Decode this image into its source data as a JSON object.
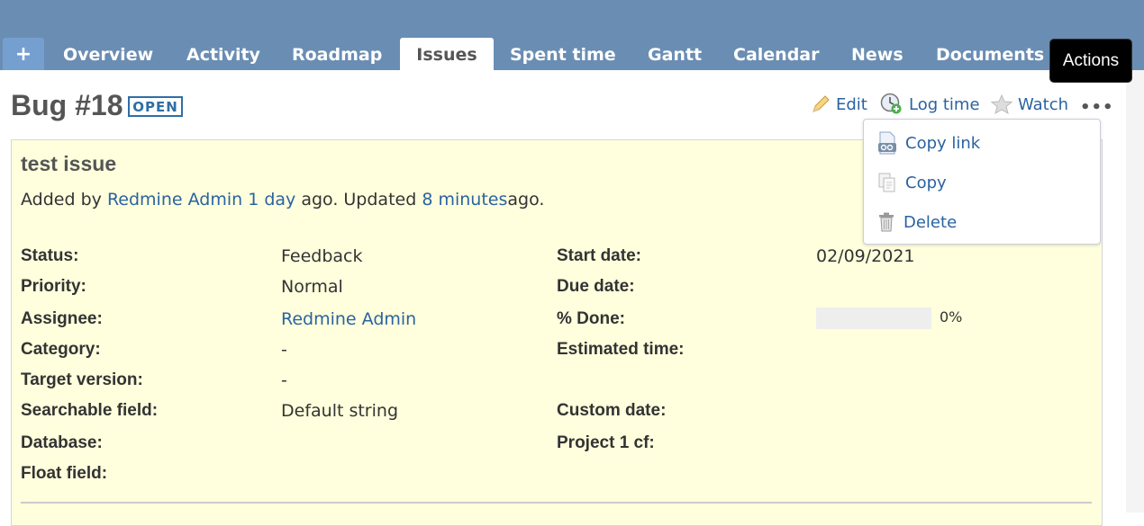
{
  "tabs": {
    "plus": "+",
    "overview": "Overview",
    "activity": "Activity",
    "roadmap": "Roadmap",
    "issues": "Issues",
    "spent_time": "Spent time",
    "gantt": "Gantt",
    "calendar": "Calendar",
    "news": "News",
    "documents": "Documents"
  },
  "tooltip": "Actions",
  "issue_header": {
    "title": "Bug #18",
    "status_badge": "OPEN"
  },
  "actions": {
    "edit": "Edit",
    "log_time": "Log time",
    "watch": "Watch",
    "more": "•••"
  },
  "dropdown": {
    "copy_link": "Copy link",
    "copy": "Copy",
    "delete": "Delete"
  },
  "issue": {
    "subject": "test issue",
    "added_by_prefix": "Added by",
    "author": "Redmine Admin",
    "created_ago": "1 day",
    "updated_text": "ago. Updated",
    "updated_ago": "8 minutes",
    "suffix": "ago."
  },
  "attributes": {
    "status_label": "Status:",
    "status": "Feedback",
    "priority_label": "Priority:",
    "priority": "Normal",
    "assignee_label": "Assignee:",
    "assignee": "Redmine Admin",
    "category_label": "Category:",
    "category": "-",
    "target_version_label": "Target version:",
    "target_version": "-",
    "searchable_field_label": "Searchable field:",
    "searchable_field": "Default string",
    "database_label": "Database:",
    "float_field_label": "Float field:",
    "start_date_label": "Start date:",
    "start_date": "02/09/2021",
    "due_date_label": "Due date:",
    "done_label": "% Done:",
    "done_value": "0%",
    "done_fraction": 0,
    "estimated_time_label": "Estimated time:",
    "custom_date_label": "Custom date:",
    "project_cf_label": "Project 1 cf:"
  },
  "colors": {
    "header": "#6a8db3",
    "link": "#2a63a0",
    "issue_bg": "#ffffdd"
  }
}
